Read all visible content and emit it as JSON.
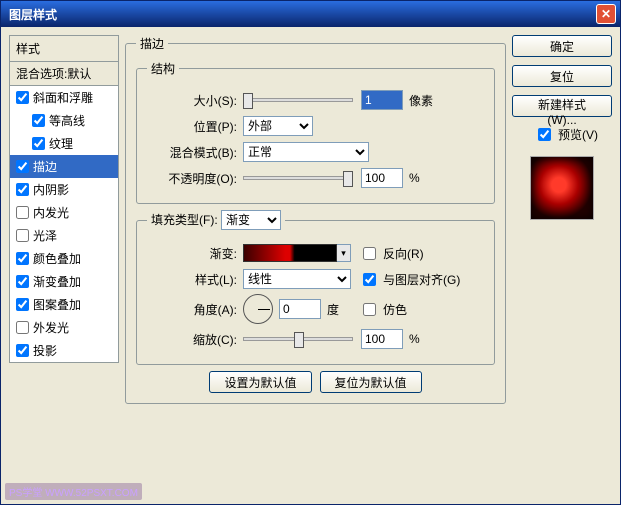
{
  "window": {
    "title": "图层样式"
  },
  "stylesHeader": "样式",
  "blendOptions": "混合选项:默认",
  "styles": [
    {
      "label": "斜面和浮雕",
      "checked": true
    },
    {
      "label": "等高线",
      "checked": true,
      "indent": true
    },
    {
      "label": "纹理",
      "checked": true,
      "indent": true
    },
    {
      "label": "描边",
      "checked": true,
      "selected": true
    },
    {
      "label": "内阴影",
      "checked": true
    },
    {
      "label": "内发光",
      "checked": false
    },
    {
      "label": "光泽",
      "checked": false
    },
    {
      "label": "颜色叠加",
      "checked": true
    },
    {
      "label": "渐变叠加",
      "checked": true
    },
    {
      "label": "图案叠加",
      "checked": true
    },
    {
      "label": "外发光",
      "checked": false
    },
    {
      "label": "投影",
      "checked": true
    }
  ],
  "stroke": {
    "group": "描边",
    "structure": "结构",
    "size_label": "大小(S):",
    "size_value": "1",
    "size_unit": "像素",
    "position_label": "位置(P):",
    "position_value": "外部",
    "blendmode_label": "混合模式(B):",
    "blendmode_value": "正常",
    "opacity_label": "不透明度(O):",
    "opacity_value": "100",
    "opacity_unit": "%",
    "filltype_label": "填充类型(F):",
    "filltype_value": "渐变",
    "gradient_label": "渐变:",
    "reverse_label": "反向(R)",
    "style_label": "样式(L):",
    "style_value": "线性",
    "align_label": "与图层对齐(G)",
    "angle_label": "角度(A):",
    "angle_value": "0",
    "angle_unit": "度",
    "dither_label": "仿色",
    "scale_label": "缩放(C):",
    "scale_value": "100",
    "scale_unit": "%",
    "btn_default": "设置为默认值",
    "btn_reset": "复位为默认值"
  },
  "right": {
    "ok": "确定",
    "cancel": "复位",
    "newstyle": "新建样式(W)...",
    "preview": "预览(V)"
  },
  "watermark": "PS学堂  WWW.52PSXT.COM"
}
